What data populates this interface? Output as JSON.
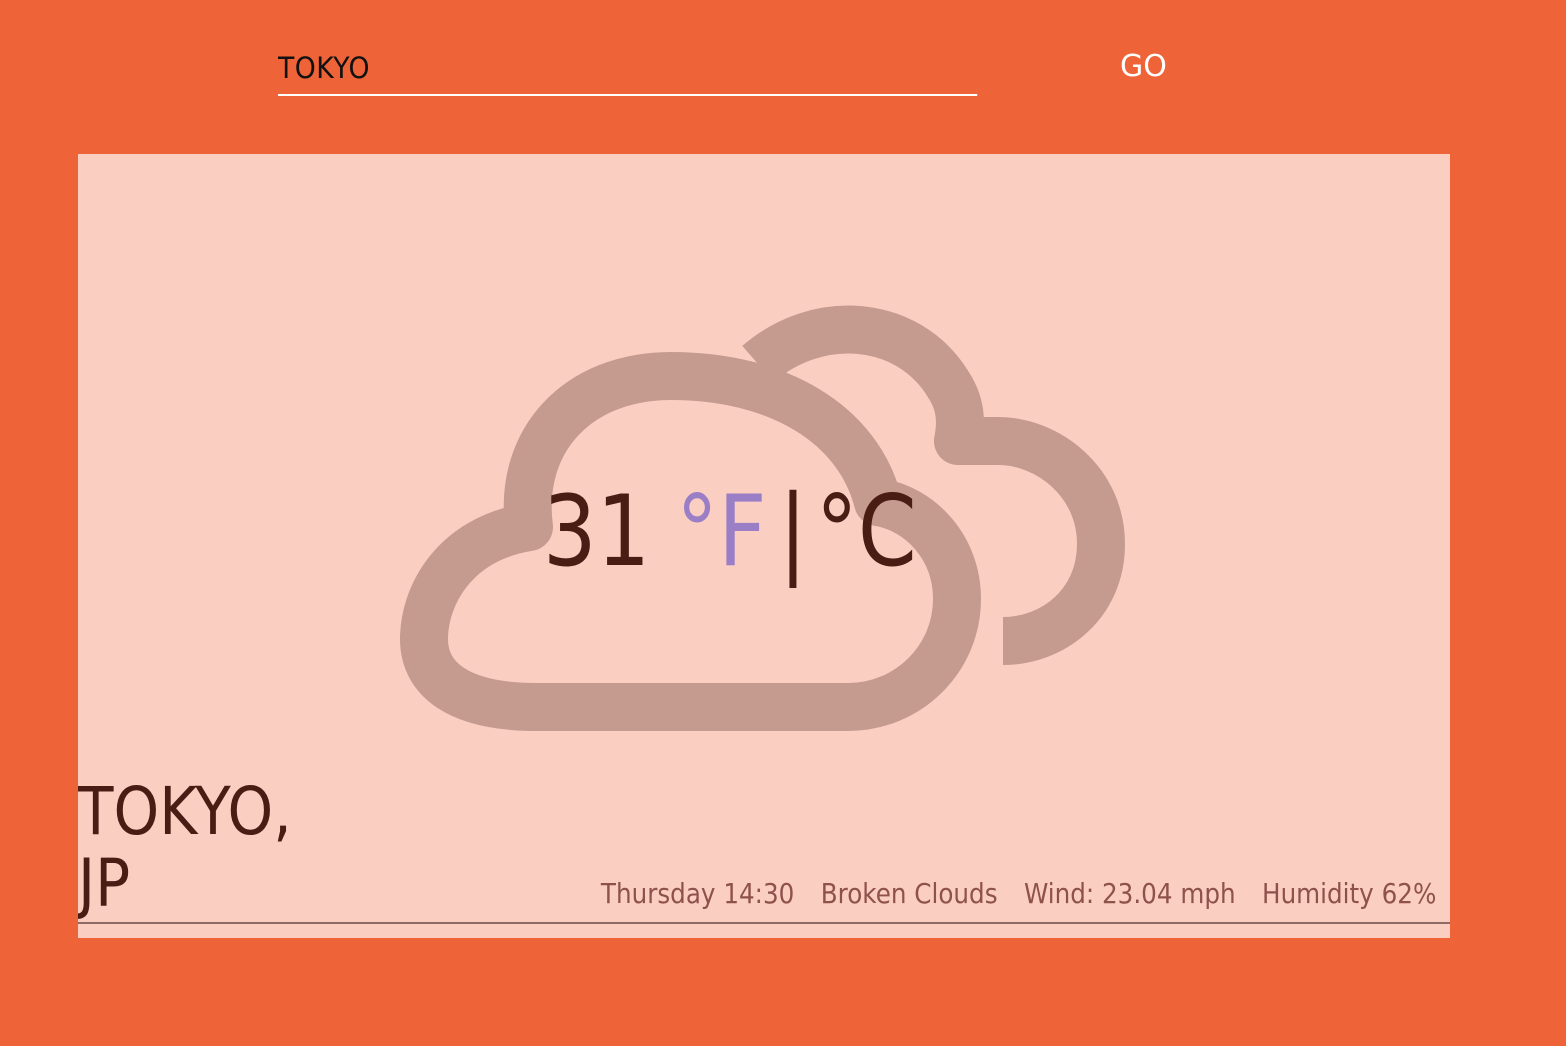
{
  "search": {
    "value": "TOKYO",
    "go_label": "GO"
  },
  "weather": {
    "temperature": "31",
    "unit_f": "°F",
    "separator": "|",
    "unit_c": "°C",
    "active_unit": "F",
    "icon": "broken-clouds-icon",
    "city": "TOKYO,",
    "country": "JP",
    "day_time": "Thursday 14:30",
    "condition": "Broken Clouds",
    "wind": "Wind: 23.04 mph",
    "humidity": "Humidity 62%"
  },
  "colors": {
    "background": "#ee6338",
    "card": "#fbcec2",
    "cloud": "#c59b8f",
    "text_dark": "#4a1d14",
    "active_unit": "#9b7fc6",
    "details_text": "#8e524b"
  }
}
